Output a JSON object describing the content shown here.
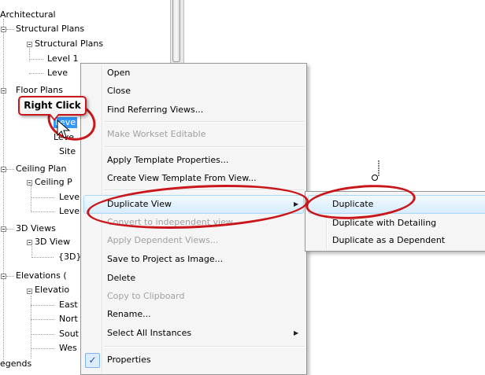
{
  "tree": {
    "architectural": "Architectural",
    "structural_plans_group": "Structural Plans",
    "structural_plans": "Structural Plans",
    "level1": "Level 1",
    "level_trunc": "Leve",
    "floor_plans_trunc": "Floor Plans",
    "selected_level": "Leve",
    "level_below": "Leve",
    "site": "Site",
    "ceiling_plans_group": "Ceiling Plan",
    "ceiling_plans": "Ceiling P",
    "ceiling_level1": "Leve",
    "ceiling_level2": "Leve",
    "three_d_views_group": "3D Views",
    "three_d_views": "3D View",
    "three_d": "{3D}",
    "elevations_group": "Elevations (",
    "elevations": "Elevatio",
    "east": "East",
    "north": "Nort",
    "south": "Sout",
    "west": "Wes",
    "legends": "egends"
  },
  "annotation": {
    "callout": "Right Click",
    "accent": "#c9161b"
  },
  "menu": {
    "open": "Open",
    "close": "Close",
    "find_referring": "Find Referring Views...",
    "make_workset_editable": "Make Workset Editable",
    "apply_template": "Apply Template Properties...",
    "create_template": "Create View Template From View...",
    "duplicate_view": "Duplicate View",
    "convert_independent": "Convert to independent view",
    "apply_dependent": "Apply Dependent Views...",
    "save_image": "Save to Project as Image...",
    "delete": "Delete",
    "copy_clipboard": "Copy to Clipboard",
    "rename": "Rename...",
    "select_all": "Select All Instances",
    "properties": "Properties",
    "properties_checked": true
  },
  "submenu": {
    "duplicate": "Duplicate",
    "duplicate_detailing": "Duplicate with Detailing",
    "duplicate_dependent": "Duplicate as a Dependent"
  },
  "colors": {
    "selection": "#3399ff",
    "menu_bg": "#f5f5f5",
    "highlight_border": "#a8d8f6"
  }
}
